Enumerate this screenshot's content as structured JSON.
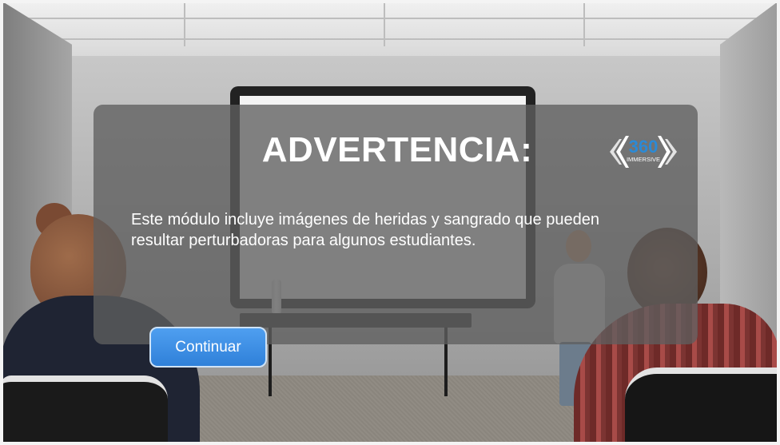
{
  "modal": {
    "title": "ADVERTENCIA:",
    "message": "Este módulo incluye imágenes de heridas y sangrado que pueden resultar perturbadoras para algunos estudiantes.",
    "continue_label": "Continuar"
  },
  "logo": {
    "number": "360",
    "word": "IMMERSIVE"
  },
  "colors": {
    "accent": "#3b8fe6",
    "logo_blue": "#2b8ad6"
  }
}
